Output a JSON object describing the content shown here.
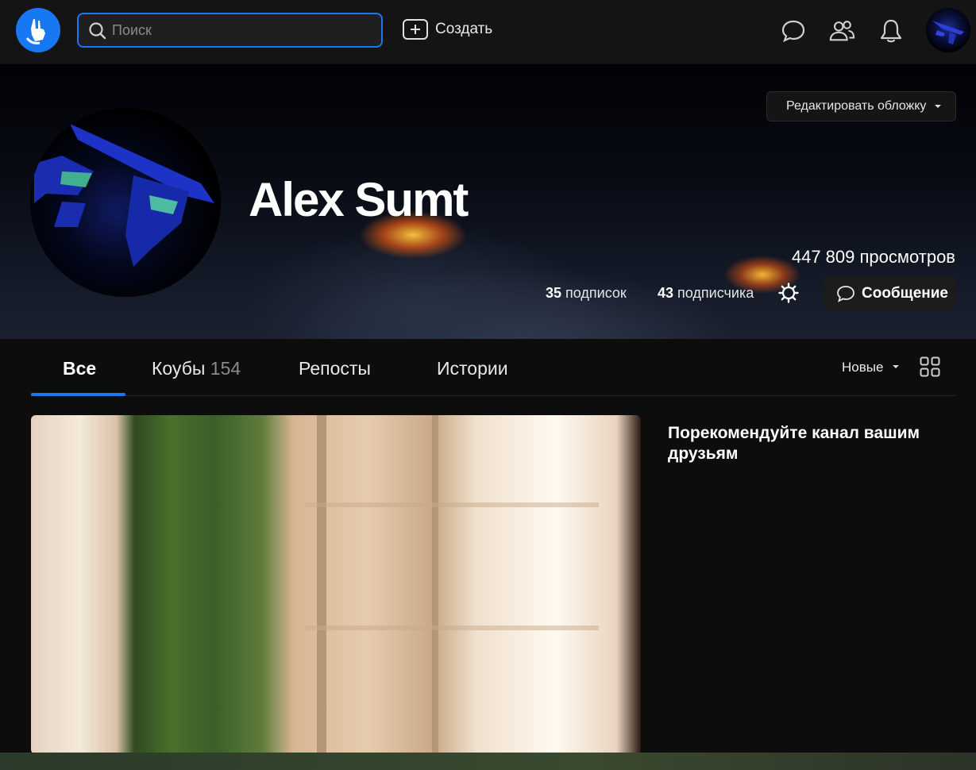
{
  "header": {
    "search_placeholder": "Поиск",
    "create_label": "Создать"
  },
  "cover": {
    "edit_cover_label": "Редактировать обложку",
    "profile_name": "Alex Sumt",
    "views": "447 809 просмотров",
    "following_count": "35",
    "following_label": "подписок",
    "followers_count": "43",
    "followers_label": "подписчика",
    "message_label": "Сообщение"
  },
  "tabs": {
    "all": "Все",
    "coubs": "Коубы",
    "coubs_count": "154",
    "reposts": "Репосты",
    "stories": "Истории"
  },
  "sort": {
    "label": "Новые"
  },
  "sidebar": {
    "recommend_title": "Порекомендуйте канал вашим друзьям"
  },
  "colors": {
    "accent": "#1877f2",
    "background": "#0d0d0d",
    "topbar": "#141414"
  }
}
